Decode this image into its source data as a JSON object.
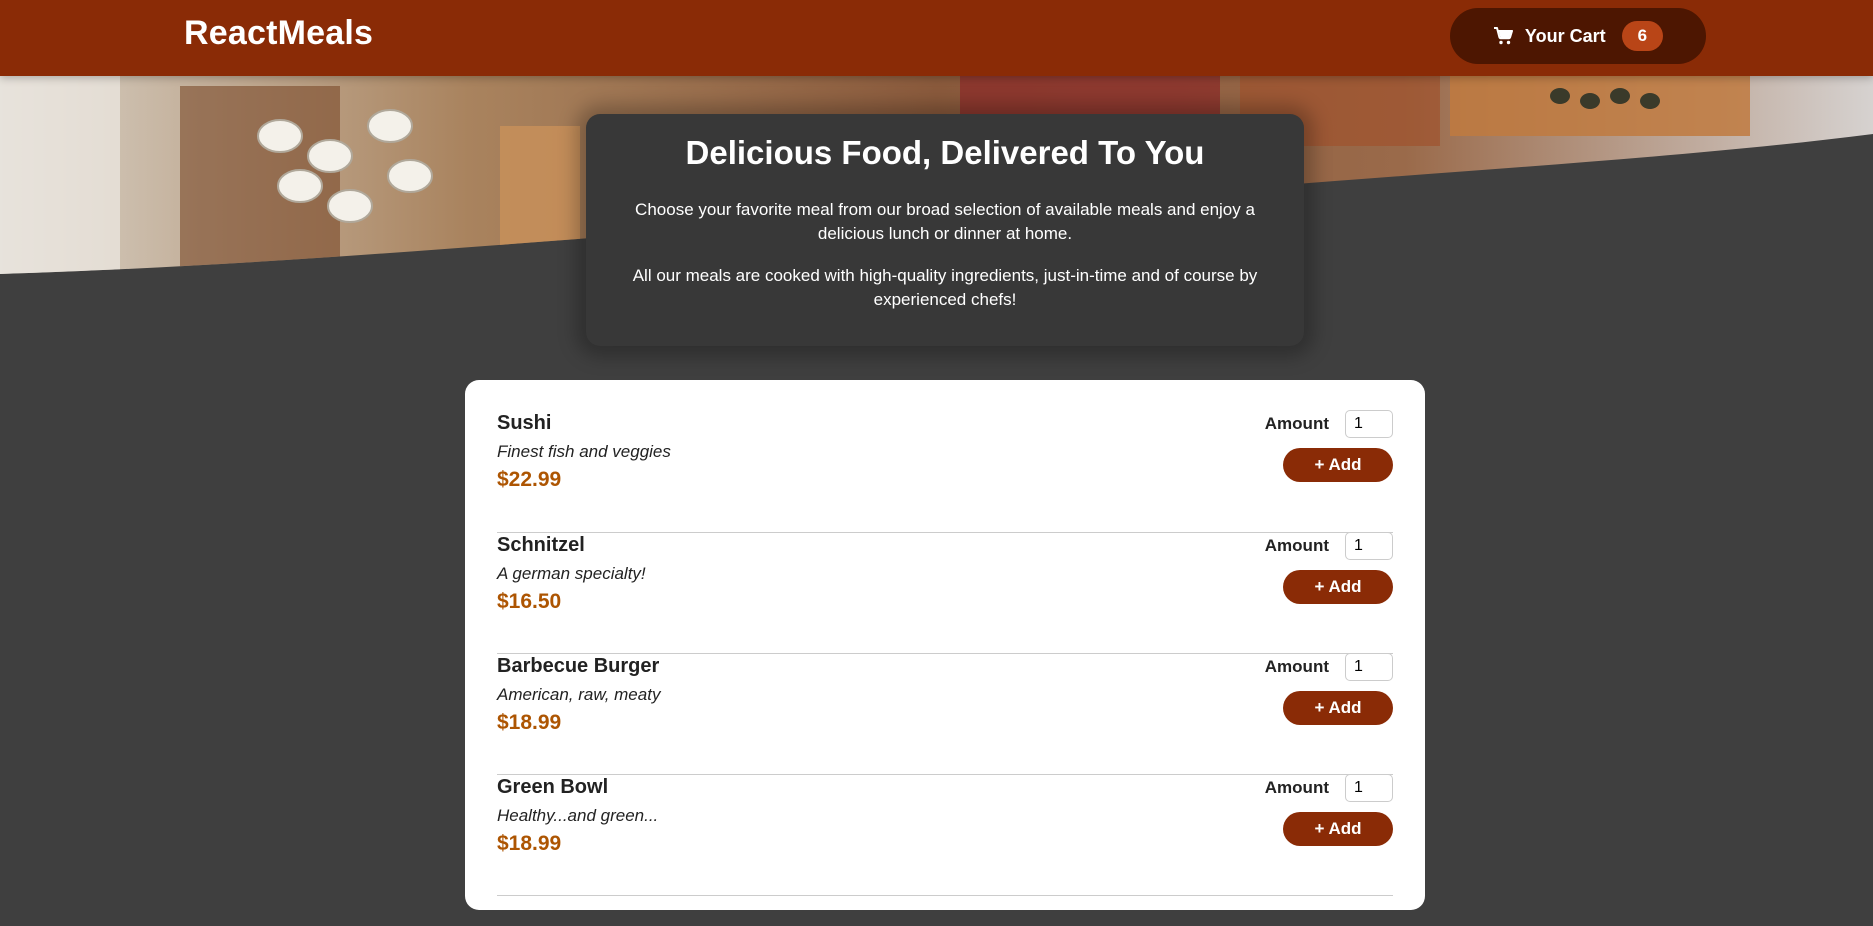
{
  "header": {
    "brand": "ReactMeals",
    "cart": {
      "label": "Your Cart",
      "count": "6",
      "icon": "cart-icon"
    }
  },
  "colors": {
    "header": "#8a2b06",
    "cart_button": "#4d1601",
    "badge": "#b94517",
    "background": "#3f3f3f",
    "summary": "#383838",
    "price": "#ad5502"
  },
  "summary": {
    "title": "Delicious Food, Delivered To You",
    "paragraph1": "Choose your favorite meal from our broad selection of available meals and enjoy a delicious lunch or dinner at home.",
    "paragraph2": "All our meals are cooked with high-quality ingredients, just-in-time and of course by experienced chefs!"
  },
  "meals": [
    {
      "name": "Sushi",
      "description": "Finest fish and veggies",
      "price": "$22.99",
      "amount_label": "Amount",
      "amount": "1",
      "add_label": "+ Add"
    },
    {
      "name": "Schnitzel",
      "description": "A german specialty!",
      "price": "$16.50",
      "amount_label": "Amount",
      "amount": "1",
      "add_label": "+ Add"
    },
    {
      "name": "Barbecue Burger",
      "description": "American, raw, meaty",
      "price": "$18.99",
      "amount_label": "Amount",
      "amount": "1",
      "add_label": "+ Add"
    },
    {
      "name": "Green Bowl",
      "description": "Healthy...and green...",
      "price": "$18.99",
      "amount_label": "Amount",
      "amount": "1",
      "add_label": "+ Add"
    }
  ]
}
